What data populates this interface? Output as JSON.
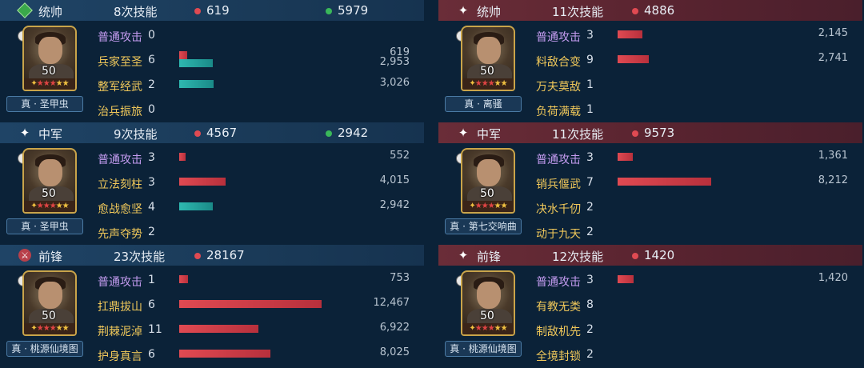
{
  "left": [
    {
      "role": "统帅",
      "role_icon": "diamond-icon",
      "skills": "8次技能",
      "damage": "619",
      "heal": "5979",
      "level": "50",
      "tag": "真 · 圣甲虫",
      "rows": [
        {
          "name": "普通攻击",
          "count": "0",
          "normal": true,
          "bars": []
        },
        {
          "name": "兵家至圣",
          "count": "6",
          "bars": [
            {
              "type": "red",
              "w": 10,
              "label": "619"
            },
            {
              "type": "teal",
              "w": 42,
              "label": "2,953"
            }
          ]
        },
        {
          "name": "整军经武",
          "count": "2",
          "bars": [
            {
              "type": "teal",
              "w": 43,
              "label": "3,026"
            }
          ]
        },
        {
          "name": "治兵振旅",
          "count": "0",
          "bars": []
        }
      ]
    },
    {
      "role": "中军",
      "role_icon": "spark-icon",
      "skills": "9次技能",
      "damage": "4567",
      "heal": "2942",
      "level": "50",
      "tag": "真 · 圣甲虫",
      "rows": [
        {
          "name": "普通攻击",
          "count": "3",
          "normal": true,
          "bars": [
            {
              "type": "red",
              "w": 8,
              "label": "552"
            }
          ]
        },
        {
          "name": "立法刻柱",
          "count": "3",
          "bars": [
            {
              "type": "red",
              "w": 58,
              "label": "4,015"
            }
          ]
        },
        {
          "name": "愈战愈坚",
          "count": "4",
          "bars": [
            {
              "type": "teal",
              "w": 42,
              "label": "2,942"
            }
          ]
        },
        {
          "name": "先声夺势",
          "count": "2",
          "bars": []
        }
      ]
    },
    {
      "role": "前锋",
      "role_icon": "sword-icon",
      "skills": "23次技能",
      "damage": "28167",
      "heal": "",
      "level": "50",
      "tag": "真 · 桃源仙境图",
      "rows": [
        {
          "name": "普通攻击",
          "count": "1",
          "normal": true,
          "bars": [
            {
              "type": "red",
              "w": 11,
              "label": "753"
            }
          ]
        },
        {
          "name": "扛鼎拔山",
          "count": "6",
          "bars": [
            {
              "type": "red",
              "w": 178,
              "label": "12,467"
            }
          ]
        },
        {
          "name": "荆棘泥淖",
          "count": "11",
          "bars": [
            {
              "type": "red",
              "w": 99,
              "label": "6,922"
            }
          ]
        },
        {
          "name": "护身真言",
          "count": "6",
          "bars": [
            {
              "type": "red",
              "w": 114,
              "label": "8,025"
            }
          ]
        }
      ]
    }
  ],
  "right": [
    {
      "role": "统帅",
      "role_icon": "spark-icon",
      "skills": "11次技能",
      "damage": "4886",
      "heal": "",
      "level": "50",
      "tag": "真 · 离骚",
      "rows": [
        {
          "name": "普通攻击",
          "count": "3",
          "normal": true,
          "bars": [
            {
              "type": "red",
              "w": 31,
              "label": "2,145"
            }
          ]
        },
        {
          "name": "料敌合变",
          "count": "9",
          "bars": [
            {
              "type": "red",
              "w": 39,
              "label": "2,741"
            }
          ]
        },
        {
          "name": "万夫莫敌",
          "count": "1",
          "bars": []
        },
        {
          "name": "负荷满载",
          "count": "1",
          "bars": []
        }
      ]
    },
    {
      "role": "中军",
      "role_icon": "spark-icon",
      "skills": "11次技能",
      "damage": "9573",
      "heal": "",
      "level": "50",
      "tag": "真 · 第七交响曲",
      "rows": [
        {
          "name": "普通攻击",
          "count": "3",
          "normal": true,
          "bars": [
            {
              "type": "red",
              "w": 19,
              "label": "1,361"
            }
          ]
        },
        {
          "name": "销兵偃武",
          "count": "7",
          "bars": [
            {
              "type": "red",
              "w": 117,
              "label": "8,212"
            }
          ]
        },
        {
          "name": "决水千仞",
          "count": "2",
          "bars": []
        },
        {
          "name": "动于九天",
          "count": "2",
          "bars": []
        }
      ]
    },
    {
      "role": "前锋",
      "role_icon": "spark-icon",
      "skills": "12次技能",
      "damage": "1420",
      "heal": "",
      "level": "50",
      "tag": "真 · 桃源仙境图",
      "rows": [
        {
          "name": "普通攻击",
          "count": "3",
          "normal": true,
          "bars": [
            {
              "type": "red",
              "w": 20,
              "label": "1,420"
            }
          ]
        },
        {
          "name": "有教无类",
          "count": "8",
          "bars": []
        },
        {
          "name": "制敌机先",
          "count": "2",
          "bars": []
        },
        {
          "name": "全境封锁",
          "count": "2",
          "bars": []
        }
      ]
    }
  ],
  "colors": {
    "damage_dot": "#e04a52",
    "heal_dot": "#3ab85a"
  }
}
